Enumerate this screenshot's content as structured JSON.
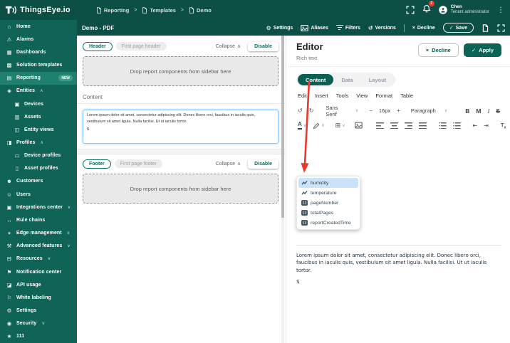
{
  "brand": {
    "name": "ThingsEye.io"
  },
  "breadcrumb": {
    "separator": ">",
    "items": [
      {
        "label": "Reporting"
      },
      {
        "label": "Templates"
      },
      {
        "label": "Demo"
      }
    ]
  },
  "topbar": {
    "user_name": "Chen",
    "user_role": "Tenant administrator",
    "notification_count": "2"
  },
  "sidebar": {
    "items": [
      {
        "icon": "⌂",
        "label": "Home"
      },
      {
        "icon": "⚠",
        "label": "Alarms"
      },
      {
        "icon": "▦",
        "label": "Dashboards"
      },
      {
        "icon": "▩",
        "label": "Solution templates"
      },
      {
        "icon": "▤",
        "label": "Reporting",
        "badge": "NEW",
        "active": true
      },
      {
        "icon": "◈",
        "label": "Entities",
        "chevron": "∧"
      },
      {
        "icon": "▣",
        "label": "Devices",
        "indent": true
      },
      {
        "icon": "▥",
        "label": "Assets",
        "indent": true
      },
      {
        "icon": "◫",
        "label": "Entity views",
        "indent": true
      },
      {
        "icon": "◨",
        "label": "Profiles",
        "chevron": "∧"
      },
      {
        "icon": "▭",
        "label": "Device profiles",
        "indent": true
      },
      {
        "icon": "▯",
        "label": "Asset profiles",
        "indent": true
      },
      {
        "icon": "☻",
        "label": "Customers"
      },
      {
        "icon": "☺",
        "label": "Users"
      },
      {
        "icon": "▣",
        "label": "Integrations center",
        "chevron": "∨"
      },
      {
        "icon": "↔",
        "label": "Rule chains"
      },
      {
        "icon": "⌖",
        "label": "Edge management",
        "chevron": "∨"
      },
      {
        "icon": "⚒",
        "label": "Advanced features",
        "chevron": "∨"
      },
      {
        "icon": "⊟",
        "label": "Resources",
        "chevron": "∨"
      },
      {
        "icon": "⚑",
        "label": "Notification center"
      },
      {
        "icon": "◪",
        "label": "API usage"
      },
      {
        "icon": "⚐",
        "label": "White labeling"
      },
      {
        "icon": "⚙",
        "label": "Settings"
      },
      {
        "icon": "◉",
        "label": "Security",
        "chevron": "∨"
      },
      {
        "icon": "★",
        "label": "111"
      }
    ]
  },
  "toolbar": {
    "title": "Demo - PDF",
    "settings": "Settings",
    "aliases": "Aliases",
    "filters": "Filters",
    "versions": "Versions",
    "decline": "Decline",
    "save": "Save"
  },
  "panel": {
    "header": {
      "chip": "Header",
      "subchip": "First page header",
      "collapse": "Collapse",
      "disable": "Disable"
    },
    "footer": {
      "chip": "Footer",
      "subchip": "First page footer",
      "collapse": "Collapse",
      "disable": "Disable"
    },
    "dropzone": "Drop report components from sidebar here",
    "content_label": "Content",
    "content_text": "Lorem ipsum dolor sit amet, consectetur adipiscing elit. Donec libero orci, faucibus in iaculis quis, vestibulum sit amet ligula. Nulla facilisi. Ut ut iaculis tortor.",
    "content_cursor": "$"
  },
  "editor": {
    "title": "Editor",
    "subtitle": "Rich text",
    "decline": "Decline",
    "apply": "Apply",
    "tabs": [
      {
        "label": "Content",
        "active": true
      },
      {
        "label": "Data"
      },
      {
        "label": "Layout"
      }
    ],
    "menubar": [
      {
        "label": "Edit"
      },
      {
        "label": "Insert"
      },
      {
        "label": "Tools"
      },
      {
        "label": "View"
      },
      {
        "label": "Format"
      },
      {
        "label": "Table"
      }
    ],
    "font_family": "Sans Serif",
    "font_size": "16px",
    "block_format": "Paragraph",
    "format_buttons": {
      "bold": "B",
      "m": "M",
      "italic": "I",
      "strike": "S"
    },
    "body_text": "Lorem ipsum dolor sit amet, consectetur adipiscing elit. Donec libero orci, faucibus in iaculis quis, vestibulum sit amet ligula. Nulla facilisi. Ut ut iaculis tortor.",
    "cursor_text": "$",
    "autocomplete": [
      {
        "label": "humidity",
        "icon_type": "timeseries",
        "selected": true
      },
      {
        "label": "temperature",
        "icon_type": "timeseries"
      },
      {
        "label": "pageNumber",
        "icon_type": "variable"
      },
      {
        "label": "totalPages",
        "icon_type": "variable"
      },
      {
        "label": "reportCreatedTime",
        "icon_type": "variable"
      }
    ]
  },
  "glyphs": {
    "chevron_up": "∧",
    "chevron_down": "∨",
    "check": "✓",
    "close": "×",
    "kebab": "⋮",
    "undo": "↺",
    "redo": "↻",
    "minus": "−",
    "plus": "+",
    "caret": "∨",
    "table": "⊞",
    "gear": "⚙",
    "history": "↺",
    "indent": "⇥",
    "outdent": "⇤",
    "more": "<>",
    "color_a": "A",
    "tx_t": "T",
    "tx_x": "x",
    "var_braces": "{}"
  },
  "colors": {
    "header_teal": "#0b4f45",
    "sidebar_teal": "#0f6457",
    "active_item": "#1f8070",
    "accent": "#0a6e60",
    "apply_fill": "#0b6455",
    "badge_red": "#e53935",
    "annotation_arrow": "#e8392e",
    "selected_blue": "#cbe3f8",
    "new_badge": "#3d9d8a"
  }
}
